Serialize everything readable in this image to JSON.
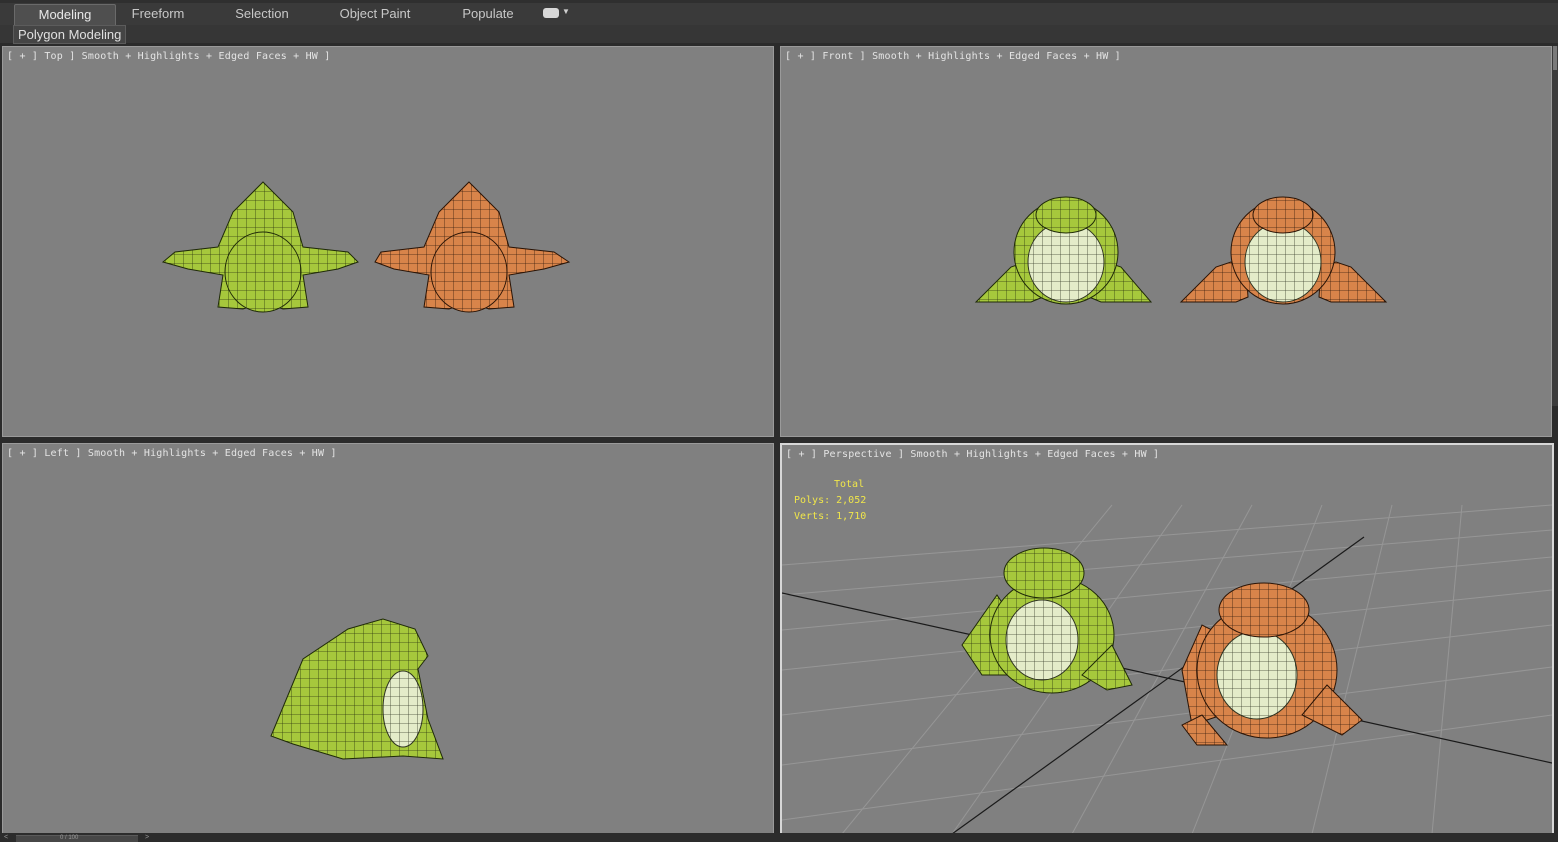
{
  "ribbon": {
    "tabs": [
      {
        "label": "Modeling",
        "active": true
      },
      {
        "label": "Freeform",
        "active": false
      },
      {
        "label": "Selection",
        "active": false
      },
      {
        "label": "Object Paint",
        "active": false
      },
      {
        "label": "Populate",
        "active": false
      }
    ],
    "menu_icon": "eye-dropdown-icon",
    "panel_label": "Polygon Modeling"
  },
  "viewports": {
    "top": {
      "label": "[ + ] Top ] Smooth + Highlights + Edged Faces + HW ]"
    },
    "front": {
      "label": "[ + ] Front ] Smooth + Highlights + Edged Faces + HW ]"
    },
    "left": {
      "label": "[ + ] Left ] Smooth + Highlights + Edged Faces + HW ]"
    },
    "perspective": {
      "label": "[ + ] Perspective ] Smooth + Highlights + Edged Faces + HW ]",
      "stats": {
        "total": "Total",
        "polys": "Polys: 2,052",
        "verts": "Verts: 1,710"
      }
    }
  },
  "models": [
    {
      "name": "green-frog",
      "color": "#9cc23a"
    },
    {
      "name": "orange-frog",
      "color": "#d9824a"
    }
  ],
  "colors": {
    "viewport_bg": "#808080",
    "stats_text": "#f0e64a",
    "belly": "#dfe8c4"
  },
  "time_slider": {
    "text": "0 / 100"
  }
}
